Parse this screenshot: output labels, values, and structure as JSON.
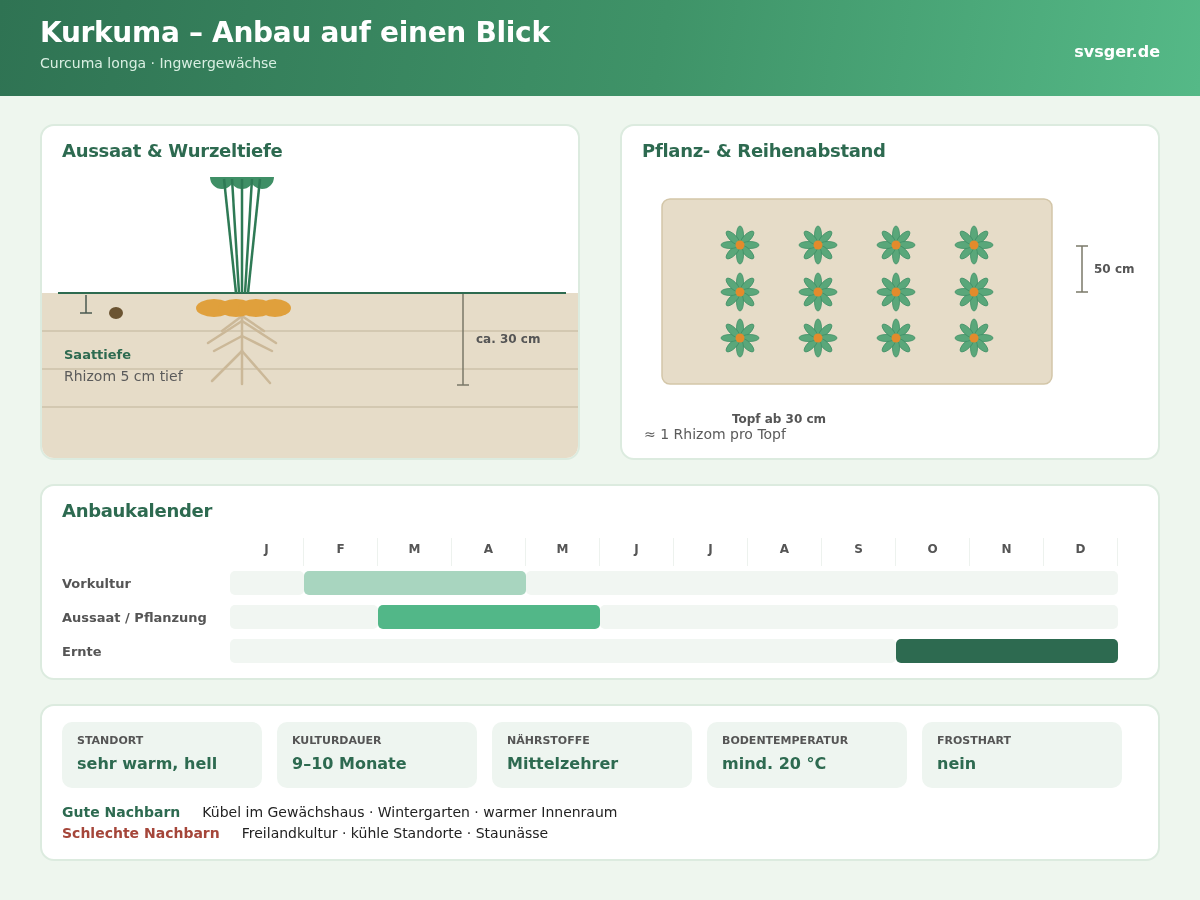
{
  "header": {
    "title": "Kurkuma – Anbau auf einen Blick",
    "subtitle": "Curcuma longa · Ingwergewächse",
    "site": "svsger.de"
  },
  "sowing": {
    "title": "Aussaat & Wurzeltiefe",
    "depth_label": "Saattiefe",
    "depth_text": "Rhizom 5 cm tief",
    "root_depth": "ca. 30 cm"
  },
  "spacing": {
    "title": "Pflanz- & Reihenabstand",
    "row_distance": "50 cm",
    "pot_size": "Topf ab 30 cm",
    "note": "≈ 1 Rhizom pro Topf"
  },
  "calendar": {
    "title": "Anbaukalender",
    "months": [
      "J",
      "F",
      "M",
      "A",
      "M",
      "J",
      "J",
      "A",
      "S",
      "O",
      "N",
      "D"
    ],
    "rows": [
      {
        "label": "Vorkultur",
        "color": "#a8d5bf",
        "months": [
          false,
          true,
          true,
          true,
          false,
          false,
          false,
          false,
          false,
          false,
          false,
          false
        ]
      },
      {
        "label": "Aussaat / Pflanzung",
        "color": "#52b788",
        "months": [
          false,
          false,
          true,
          true,
          true,
          false,
          false,
          false,
          false,
          false,
          false,
          false
        ]
      },
      {
        "label": "Ernte",
        "color": "#2d6a50",
        "months": [
          false,
          false,
          false,
          false,
          false,
          false,
          false,
          false,
          false,
          true,
          true,
          true
        ]
      }
    ]
  },
  "facts": [
    {
      "label": "STANDORT",
      "value": "sehr warm, hell"
    },
    {
      "label": "KULTURDAUER",
      "value": "9–10 Monate"
    },
    {
      "label": "NÄHRSTOFFE",
      "value": "Mittelzehrer"
    },
    {
      "label": "BODENTEMPERATUR",
      "value": "mind. 20 °C"
    },
    {
      "label": "FROSTHART",
      "value": "nein"
    }
  ],
  "neighbors": [
    {
      "label": "Gute Nachbarn",
      "color": "#2d6a50",
      "text": "Kübel im Gewächshaus · Wintergarten · warmer Innenraum"
    },
    {
      "label": "Schlechte Nachbarn",
      "color": "#a5463a",
      "text": "Freilandkultur · kühle Standorte · Staunässe"
    }
  ]
}
